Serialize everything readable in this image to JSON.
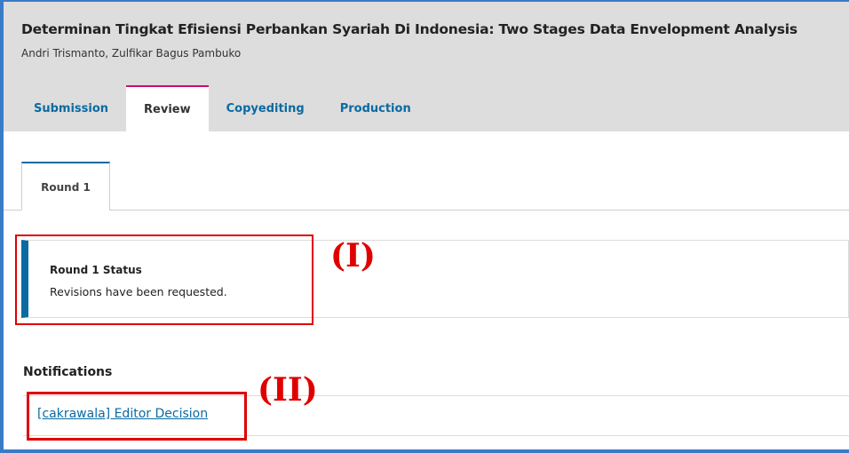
{
  "submission": {
    "title": "Determinan Tingkat Efisiensi Perbankan Syariah Di Indonesia: Two Stages Data Envelopment Analysis",
    "authors": "Andri Trismanto, Zulfikar Bagus Pambuko"
  },
  "tabs": [
    {
      "label": "Submission"
    },
    {
      "label": "Review"
    },
    {
      "label": "Copyediting"
    },
    {
      "label": "Production"
    }
  ],
  "active_tab": "Review",
  "round_tabs": [
    {
      "label": "Round 1"
    }
  ],
  "status": {
    "title": "Round 1 Status",
    "text": "Revisions have been requested."
  },
  "notifications": {
    "heading": "Notifications",
    "items": [
      {
        "label": "[cakrawala] Editor Decision"
      }
    ]
  },
  "annotations": {
    "label_1": "(I)",
    "label_2": "(II)"
  },
  "colors": {
    "accent_link": "#0a6aa1",
    "active_tab_border": "#d00a6c",
    "annotation_red": "#e00000",
    "frame_blue": "#3a7bc8"
  }
}
